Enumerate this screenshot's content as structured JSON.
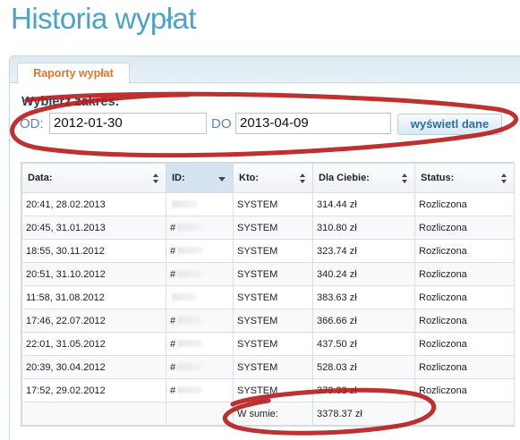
{
  "page": {
    "title": "Historia wypłat"
  },
  "panel": {
    "tab_label": "Raporty wypłat"
  },
  "filter": {
    "heading": "Wybierz zakres:",
    "from_label": "OD:",
    "from_value": "2012-01-30",
    "to_label": "DO",
    "to_value": "2013-04-09",
    "submit_label": "wyświetl dane"
  },
  "table": {
    "columns": [
      "Data:",
      "ID:",
      "Kto:",
      "Dla Ciebie:",
      "Status:"
    ],
    "sorted_column": "ID:",
    "rows": [
      {
        "date": "20:41, 28.02.2013",
        "id": "",
        "who": "SYSTEM",
        "amount": "314.44 zł",
        "status": "Rozliczona"
      },
      {
        "date": "20:45, 31.01.2013",
        "id": "#",
        "who": "SYSTEM",
        "amount": "310.80 zł",
        "status": "Rozliczona"
      },
      {
        "date": "18:55, 30.11.2012",
        "id": "#",
        "who": "SYSTEM",
        "amount": "323.74 zł",
        "status": "Rozliczona"
      },
      {
        "date": "20:51, 31.10.2012",
        "id": "#",
        "who": "SYSTEM",
        "amount": "340.24 zł",
        "status": "Rozliczona"
      },
      {
        "date": "11:58, 31.08.2012",
        "id": "",
        "who": "SYSTEM",
        "amount": "383.63 zł",
        "status": "Rozliczona"
      },
      {
        "date": "17:46, 22.07.2012",
        "id": "#",
        "who": "SYSTEM",
        "amount": "366.66 zł",
        "status": "Rozliczona"
      },
      {
        "date": "22:01, 31.05.2012",
        "id": "#",
        "who": "SYSTEM",
        "amount": "437.50 zł",
        "status": "Rozliczona"
      },
      {
        "date": "20:39, 30.04.2012",
        "id": "#",
        "who": "SYSTEM",
        "amount": "528.03 zł",
        "status": "Rozliczona"
      },
      {
        "date": "17:52, 29.02.2012",
        "id": "#",
        "who": "SYSTEM",
        "amount": "373.33 zł",
        "status": "Rozliczona"
      }
    ],
    "sum_label": "W sumie:",
    "sum_value": "3378.37 zł"
  },
  "annotation": {
    "color": "#b8191a"
  }
}
